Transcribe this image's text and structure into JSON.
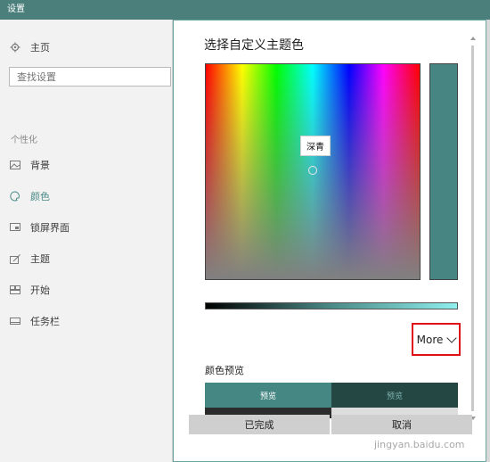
{
  "window": {
    "title": "设置"
  },
  "sidebar": {
    "home": {
      "label": "主页",
      "icon": "gear-icon"
    },
    "search_placeholder": "查找设置",
    "section_label": "个性化",
    "items": [
      {
        "label": "背景",
        "icon": "image-icon",
        "active": false
      },
      {
        "label": "颜色",
        "icon": "palette-icon",
        "active": true
      },
      {
        "label": "锁屏界面",
        "icon": "lockscreen-icon",
        "active": false
      },
      {
        "label": "主题",
        "icon": "theme-icon",
        "active": false
      },
      {
        "label": "开始",
        "icon": "start-icon",
        "active": false
      },
      {
        "label": "任务栏",
        "icon": "taskbar-icon",
        "active": false
      }
    ]
  },
  "dialog": {
    "title": "选择自定义主题色",
    "picker_tooltip": "深青",
    "selected_color": "#468581",
    "brightness_slider_value": 0.5,
    "more_label": "More",
    "preview": {
      "title": "颜色预览",
      "light_label": "预览",
      "dark_label": "预览",
      "accent_color": "#458783",
      "dark_accent_color": "#254744"
    },
    "done_label": "已完成",
    "cancel_label": "取消"
  },
  "watermark": "jingyan.baidu.com",
  "colors": {
    "titlebar": "#4a7f7b",
    "accent": "#4a8a86",
    "highlight_box": "#e0101a"
  }
}
